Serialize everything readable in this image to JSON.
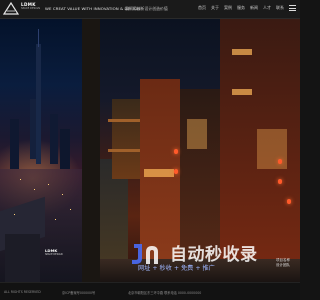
{
  "header": {
    "logo_title": "LDMK",
    "logo_sub": "SPACE DESIGN",
    "slogan": "WE CREAT VALUE WITH INNOVATION & DESIGN",
    "slogan_cn": "我们用创新设计创造价值",
    "nav": [
      "首页",
      "关于",
      "案例",
      "服务",
      "新闻",
      "人才",
      "联系"
    ]
  },
  "city_label": {
    "title": "LDMK",
    "sub": "SPACE DESIGN"
  },
  "watermark": {
    "title": "自动秒收录",
    "subtitle": "网址 + 秒收 + 免费 + 推广"
  },
  "corner_tag": [
    "项目名称",
    "设计团队"
  ],
  "footer": {
    "copyright": "ALL RIGHTS RESERVED",
    "icp": "京ICP备案号000000号",
    "address": "北京市朝阳区东三环中路 联系电话 0000-0000000"
  },
  "colors": {
    "accent_blue": "#4a6cf5",
    "lamp_red": "#ff5a2a",
    "header_bg": "#1a1a1a"
  }
}
